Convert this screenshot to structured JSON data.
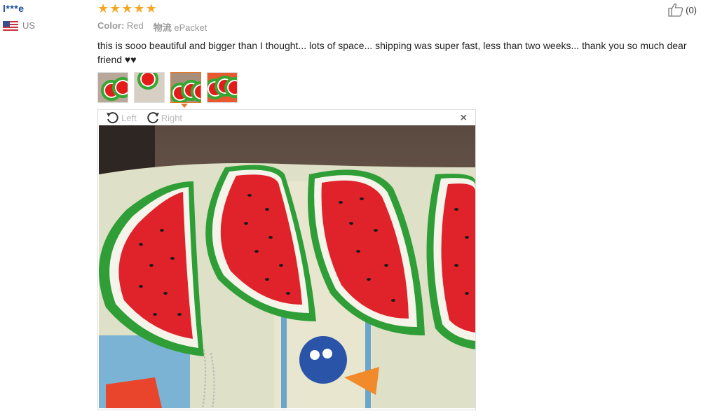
{
  "reviewer": {
    "name": "l***e",
    "country": "US"
  },
  "rating": {
    "stars": 5,
    "max": 5
  },
  "helpful": {
    "label": "(0)",
    "icon": "thumbs-up-icon"
  },
  "attributes": [
    {
      "key": "Color:",
      "value": "Red"
    },
    {
      "key": "物流",
      "value": "ePacket"
    }
  ],
  "review_text": "this is sooo beautiful and bigger than I thought... lots of space... shipping was super fast, less than two weeks... thank you so much dear friend ♥♥",
  "thumbnails": [
    {
      "name": "thumbnail-1",
      "active": false
    },
    {
      "name": "thumbnail-2",
      "active": false
    },
    {
      "name": "thumbnail-3",
      "active": true
    },
    {
      "name": "thumbnail-4",
      "active": false
    }
  ],
  "viewer": {
    "rotate_left_label": "Left",
    "rotate_right_label": "Right",
    "close_label": "×"
  },
  "colors": {
    "name": "#1a4e9c",
    "star": "#f6a623",
    "active_border": "#e27b2a"
  }
}
